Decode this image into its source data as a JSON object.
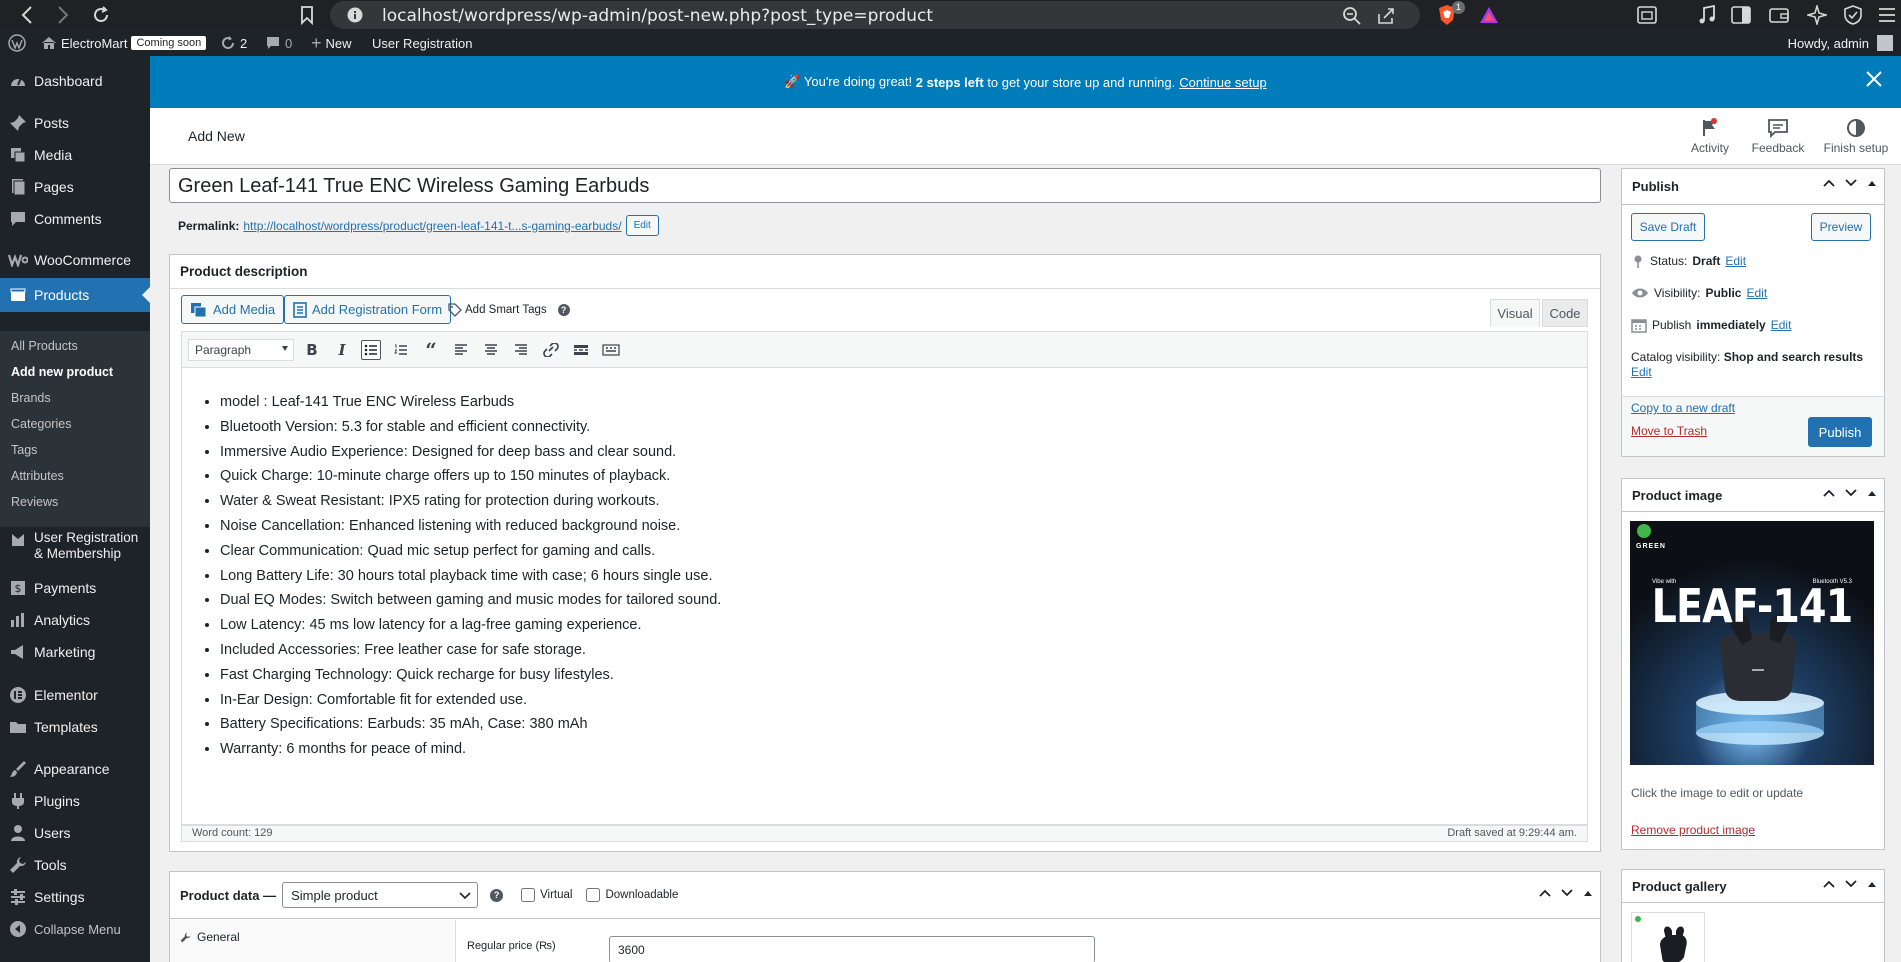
{
  "browser": {
    "url": "localhost/wordpress/wp-admin/post-new.php?post_type=product",
    "extension_badge": "1"
  },
  "admin_bar": {
    "site_name": "ElectroMart",
    "coming_soon": "Coming soon",
    "updates_count": "2",
    "comments_count": "0",
    "new_label": "New",
    "user_registration": "User Registration",
    "howdy": "Howdy, admin"
  },
  "sidebar": {
    "items": [
      {
        "label": "Dashboard",
        "icon": "dashboard-icon"
      },
      {
        "label": "Posts",
        "icon": "pin-icon"
      },
      {
        "label": "Media",
        "icon": "media-icon"
      },
      {
        "label": "Pages",
        "icon": "page-icon"
      },
      {
        "label": "Comments",
        "icon": "comment-icon"
      },
      {
        "label": "WooCommerce",
        "icon": "woo-icon"
      },
      {
        "label": "Products",
        "icon": "products-icon"
      },
      {
        "label": "User Registration",
        "label2": "& Membership",
        "icon": "user-reg-icon"
      },
      {
        "label": "Payments",
        "icon": "payments-icon"
      },
      {
        "label": "Analytics",
        "icon": "analytics-icon"
      },
      {
        "label": "Marketing",
        "icon": "marketing-icon"
      },
      {
        "label": "Elementor",
        "icon": "elementor-icon"
      },
      {
        "label": "Templates",
        "icon": "folder-icon"
      },
      {
        "label": "Appearance",
        "icon": "brush-icon"
      },
      {
        "label": "Plugins",
        "icon": "plugin-icon"
      },
      {
        "label": "Users",
        "icon": "users-icon"
      },
      {
        "label": "Tools",
        "icon": "wrench-icon"
      },
      {
        "label": "Settings",
        "icon": "settings-icon"
      },
      {
        "label": "Collapse Menu",
        "icon": "collapse-icon"
      }
    ],
    "submenu": [
      "All Products",
      "Add new product",
      "Brands",
      "Categories",
      "Tags",
      "Attributes",
      "Reviews"
    ]
  },
  "notice": {
    "prefix": "🚀 You're doing great!",
    "bold": "2 steps left",
    "suffix": "to get your store up and running.",
    "link": "Continue setup"
  },
  "header": {
    "title": "Add New",
    "buttons": [
      "Activity",
      "Feedback",
      "Finish setup"
    ]
  },
  "post": {
    "title": "Green Leaf-141 True ENC Wireless Gaming Earbuds",
    "permalink_label": "Permalink:",
    "permalink_url": "http://localhost/wordpress/product/green-leaf-141-t...s-gaming-earbuds/",
    "permalink_edit": "Edit"
  },
  "description": {
    "heading": "Product description",
    "add_media": "Add Media",
    "add_registration_form": "Add Registration Form",
    "add_smart_tags": "Add Smart Tags",
    "tab_visual": "Visual",
    "tab_code": "Code",
    "format": "Paragraph",
    "bullets": [
      "model : Leaf-141 True ENC Wireless Earbuds",
      "Bluetooth Version: 5.3 for stable and efficient connectivity.",
      "Immersive Audio Experience: Designed for deep bass and clear sound.",
      "Quick Charge: 10-minute charge offers up to 150 minutes of playback.",
      "Water & Sweat Resistant: IPX5 rating for protection during workouts.",
      "Noise Cancellation: Enhanced listening with reduced background noise.",
      "Clear Communication: Quad mic setup perfect for gaming and calls.",
      "Long Battery Life: 30 hours total playback time with case; 6 hours single use.",
      "Dual EQ Modes: Switch between gaming and music modes for tailored sound.",
      "Low Latency: 45 ms low latency for a lag-free gaming experience.",
      "Included Accessories: Free leather case for safe storage.",
      "Fast Charging Technology: Quick recharge for busy lifestyles.",
      "In-Ear Design: Comfortable fit for extended use.",
      "Battery Specifications: Earbuds: 35 mAh, Case: 380 mAh",
      "Warranty: 6 months for peace of mind."
    ],
    "word_count": "Word count: 129",
    "draft_saved": "Draft saved at 9:29:44 am."
  },
  "product_data": {
    "label": "Product data —",
    "type": "Simple product",
    "virtual": "Virtual",
    "downloadable": "Downloadable",
    "tab_general": "General",
    "regular_price_label": "Regular price (₨)",
    "regular_price": "3600"
  },
  "publish": {
    "heading": "Publish",
    "save_draft": "Save Draft",
    "preview": "Preview",
    "status_label": "Status:",
    "status_value": "Draft",
    "visibility_label": "Visibility:",
    "visibility_value": "Public",
    "publish_label": "Publish",
    "publish_value": "immediately",
    "catalog_label": "Catalog visibility:",
    "catalog_value": "Shop and search results",
    "edit": "Edit",
    "copy_draft": "Copy to a new draft",
    "trash": "Move to Trash",
    "publish_button": "Publish"
  },
  "product_image": {
    "heading": "Product image",
    "brand": "GREEN",
    "title": "LEAF-141",
    "small_left": "Vibe with",
    "small_right": "Bluetooth V5.3",
    "hint": "Click the image to edit or update",
    "remove": "Remove product image"
  },
  "gallery": {
    "heading": "Product gallery"
  }
}
